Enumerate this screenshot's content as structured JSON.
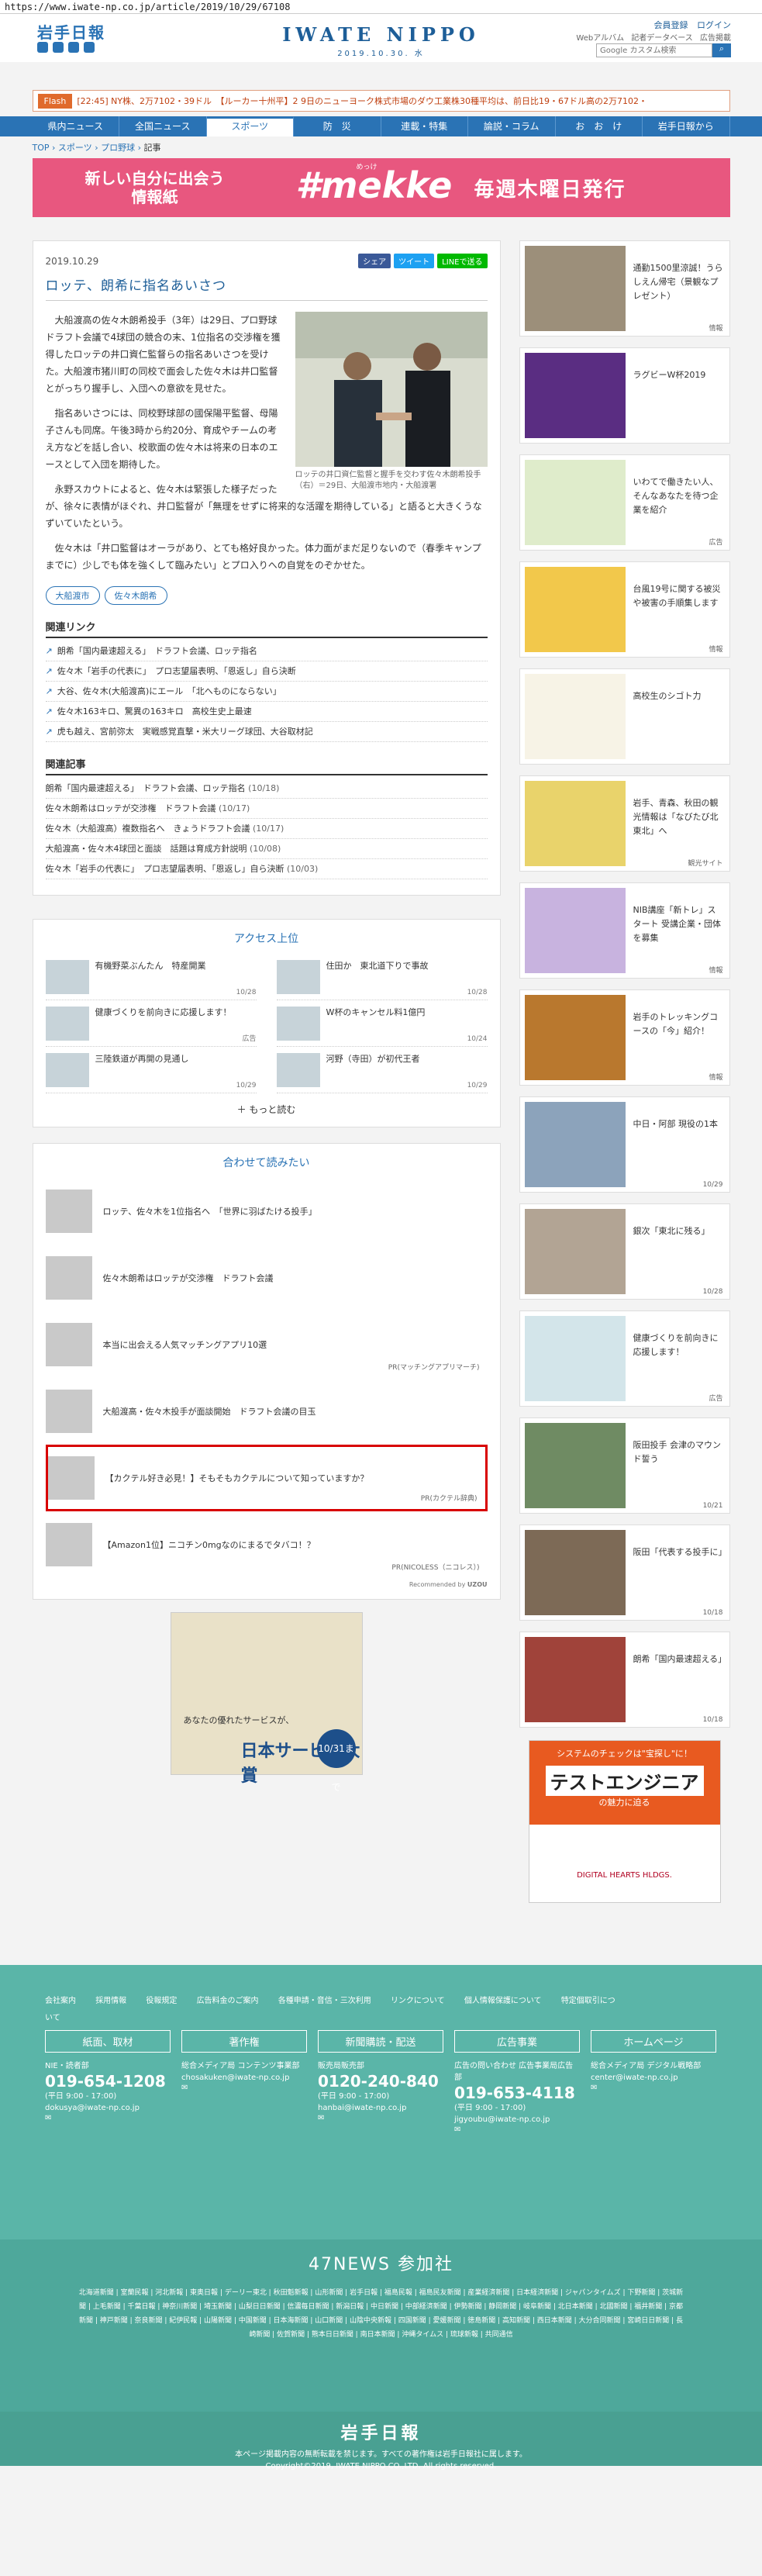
{
  "url": "https://www.iwate-np.co.jp/article/2019/10/29/67108",
  "header": {
    "logo": "岩手日報",
    "brand": "IWATE NIPPO",
    "brand_date": "2019.10.30. 水",
    "login": [
      "会員登録",
      "ログイン"
    ],
    "subnav": [
      "Webアルバム",
      "記者データベース",
      "広告掲載"
    ],
    "search_placeholder": "Google カスタム検索"
  },
  "flash": {
    "tag": "Flash",
    "text": "[22:45] NY株、2万7102・39ドル　【ルーカー十州平】2 9日のニューヨーク株式市場のダウ工業株30種平均は、前日比19・67ドル高の2万7102・"
  },
  "nav": [
    "県内ニュース",
    "全国ニュース",
    "スポーツ",
    "防　災",
    "連載・特集",
    "論説・コラム",
    "お　お　け",
    "岩手日報から"
  ],
  "breadcrumb": [
    "TOP",
    "スポーツ",
    "プロ野球",
    "記事"
  ],
  "banner": {
    "lead": "新しい自分に出会う\n情報紙",
    "ruby": "めっけ",
    "mekke": "#mekke",
    "tail": "毎週木曜日発行"
  },
  "article": {
    "date": "2019.10.29",
    "share": [
      "シェア",
      "ツイート",
      "LINEで送る"
    ],
    "headline": "ロッテ、朗希に指名あいさつ",
    "caption": "ロッテの井口資仁監督と握手を交わす佐々木朗希投手（右）＝29日、大船渡市地内・大船渡署",
    "paragraphs": [
      "大船渡高の佐々木朗希投手（3年）は29日、プロ野球ドラフト会議で4球団の競合の末、1位指名の交渉権を獲得したロッテの井口資仁監督らの指名あいさつを受けた。大船渡市猪川町の同校で面会した佐々木は井口監督とがっちり握手し、入団への意欲を見せた。",
      "指名あいさつには、同校野球部の國保陽平監督、母陽子さんも同席。午後3時から約20分、育成やチームの考え方などを話し合い、校歌面の佐々木は将来の日本のエースとして入団を期待した。",
      "永野スカウトによると、佐々木は緊張した様子だったが、徐々に表情がほぐれ、井口監督が「無理をせずに将来的な活躍を期待している」と語ると大きくうなずいていたという。",
      "佐々木は「井口監督はオーラがあり、とても格好良かった。体力面がまだ足りないので（春季キャンプまでに）少しでも体を強くして臨みたい」とプロ入りへの自覚をのぞかせた。"
    ],
    "tags": [
      "大船渡市",
      "佐々木朗希"
    ],
    "related_links_title": "関連リンク",
    "related_links": [
      "朗希「国内最速超える」　ドラフト会議、ロッテ指名",
      "佐々木「岩手の代表に」　プロ志望届表明、「恩返し」自ら決断",
      "大谷、佐々木(大船渡高)にエール　「北へものにならない」",
      "佐々木163キロ、驚異の163キロ　高校生史上最速",
      "虎も越え、宮前弥太　実戦感覚直撃・米大リーグ球団、大谷取材記"
    ],
    "related_articles_title": "関連記事",
    "related_articles": [
      {
        "t": "朗希「国内最速超える」　ドラフト会議、ロッテ指名",
        "d": "(10/18)"
      },
      {
        "t": "佐々木朗希はロッテが交渉権　ドラフト会議",
        "d": "(10/17)"
      },
      {
        "t": "佐々木（大船渡高）複数指名へ　きょうドラフト会議",
        "d": "(10/17)"
      },
      {
        "t": "大船渡高・佐々木4球団と面談　話題は育成方針説明",
        "d": "(10/08)"
      },
      {
        "t": "佐々木「岩手の代表に」　プロ志望届表明、「恩返し」自ら決断",
        "d": "(10/03)"
      }
    ]
  },
  "access": {
    "title": "アクセス上位",
    "items": [
      {
        "t": "有機野菜ぶんたん　特産開業",
        "d": "10/28"
      },
      {
        "t": "住田か　東北道下りで事故",
        "d": "10/28"
      },
      {
        "t": "健康づくりを前向きに応援します！",
        "d": "広告"
      },
      {
        "t": "W杯のキャンセル料1億円",
        "d": "10/24"
      },
      {
        "t": "三陸鉄道が再開の見通し",
        "d": "10/29"
      },
      {
        "t": "河野（寺田）が初代王者",
        "d": "10/29"
      }
    ],
    "more": "もっと読む"
  },
  "recommend": {
    "title": "合わせて読みたい",
    "items": [
      {
        "t": "ロッテ、佐々木を1位指名へ　「世界に羽ばたける投手」",
        "pr": ""
      },
      {
        "t": "佐々木朗希はロッテが交渉権　ドラフト会議",
        "pr": ""
      },
      {
        "t": "本当に出会える人気マッチングアプリ10選",
        "pr": "PR(マッチングアプリマーチ)"
      },
      {
        "t": "大船渡高・佐々木投手が面談開始　ドラフト会議の目玉",
        "pr": ""
      },
      {
        "t": "【カクテル好き必見！】そもそもカクテルについて知っていますか？",
        "pr": "PR(カクテル辞典)"
      },
      {
        "t": "【Amazon1位】ニコチン0mgなのにまるでタバコ！？",
        "pr": "PR(NICOLESS（ニコレス）)"
      }
    ],
    "footer": "Recommended by",
    "footer_brand": "UZOU"
  },
  "ad_bottom": {
    "small": "あなたの優れたサービスが、",
    "title": "日本サービス大賞",
    "date": "10/31まで"
  },
  "sidebar": [
    {
      "t": "通勤1500里涼誠！うらしえん帰宅（景観なプレゼント）",
      "l": "情報"
    },
    {
      "t": "ラグビーW杯2019",
      "l": ""
    },
    {
      "t": "いわてで働きたい人、そんなあなたを待つ企業を紹介",
      "l": "広告"
    },
    {
      "t": "台風19号に関する被災や被害の手順集します",
      "l": "情報"
    },
    {
      "t": "高校生のシゴト力",
      "l": ""
    },
    {
      "t": "岩手、青森、秋田の観光情報は「なびたび北東北」へ",
      "l": "観光サイト"
    },
    {
      "t": "NIB講座「新トレ」スタート 受講企業・団体を募集",
      "l": "情報"
    },
    {
      "t": "岩手のトレッキングコースの「今」紹介！",
      "l": "情報"
    },
    {
      "t": "中日・阿部 現役の1本",
      "l": "10/29"
    },
    {
      "t": "銀次「東北に残る」",
      "l": "10/28"
    },
    {
      "t": "健康づくりを前向きに応援します！",
      "l": "広告"
    },
    {
      "t": "阪田投手 会津のマウンド誓う",
      "l": "10/21"
    },
    {
      "t": "阪田「代表する投手に」",
      "l": "10/18"
    },
    {
      "t": "朗希「国内最速超える」",
      "l": "10/18"
    }
  ],
  "side_ad": {
    "top": "システムのチェックは\"宝探し\"に！",
    "big": "テストエンジニア",
    "sub": "の魅力に迫る",
    "bot": "DIGITAL HEARTS HLDGS."
  },
  "footer": {
    "links": [
      "会社案内",
      "採用情報",
      "役報規定",
      "広告料金のご案内",
      "各種申請・音信・三次利用",
      "リンクについて",
      "個人情報保護について",
      "特定個取引について"
    ],
    "cols": [
      {
        "h": "紙面、取材",
        "sub": "NIE・読者部",
        "tel": "019-654-1208",
        "time": "(平日 9:00 - 17:00)",
        "mail": "dokusya@iwate-np.co.jp"
      },
      {
        "h": "著作権",
        "sub": "総合メディア局 コンテンツ事業部",
        "tel": "",
        "time": "",
        "mail": "chosakuken@iwate-np.co.jp"
      },
      {
        "h": "新聞購読・配送",
        "sub": "販売局販売部",
        "tel": "0120-240-840",
        "time": "(平日 9:00 - 17:00)",
        "mail": "hanbai@iwate-np.co.jp"
      },
      {
        "h": "広告事業",
        "sub": "広告の問い合わせ 広告事業局広告部",
        "tel": "019-653-4118",
        "time": "(平日 9:00 - 17:00)",
        "mail": "jigyoubu@iwate-np.co.jp"
      },
      {
        "h": "ホームページ",
        "sub": "総合メディア局 デジタル戦略部",
        "tel": "",
        "time": "",
        "mail": "center@iwate-np.co.jp"
      }
    ],
    "n47_title": "47NEWS 参加社",
    "n47_list": "北海道新聞 | 室蘭民報 | 河北新報 | 東奥日報 | デーリー東北 | 秋田魁新報 | 山形新聞 | 岩手日報 | 福島民報 | 福島民友新聞 | 産業経済新聞 | 日本経済新聞 | ジャパンタイムズ | 下野新聞 | 茨城新聞 | 上毛新聞 | 千葉日報 | 神奈川新聞 | 埼玉新聞 | 山梨日日新聞 | 信濃毎日新聞 | 新潟日報 | 中日新聞 | 中部経済新聞 | 伊勢新聞 | 静岡新聞 | 岐阜新聞 | 北日本新聞 | 北國新聞 | 福井新聞 | 京都新聞 | 神戸新聞 | 奈良新聞 | 紀伊民報 | 山陽新聞 | 中国新聞 | 日本海新聞 | 山口新聞 | 山陰中央新報 | 四国新聞 | 愛媛新聞 | 徳島新聞 | 高知新聞 | 西日本新聞 | 大分合同新聞 | 宮崎日日新聞 | 長崎新聞 | 佐賀新聞 | 熊本日日新聞 | 南日本新聞 | 沖縄タイムス | 琉球新報 | 共同通信",
    "logo": "岩手日報",
    "copyright1": "本ページ掲載内容の無断転載を禁じます。すべての著作権は岩手日報社に属します。",
    "copyright2": "Copyright©2019, IWATE NIPPO CO.,LTD. All rights reserved."
  }
}
